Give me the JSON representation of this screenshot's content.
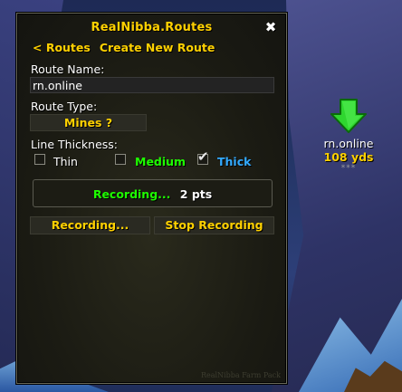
{
  "window": {
    "title": "RealNibba.Routes",
    "close_glyph": "✖",
    "watermark": "RealNibba Farm Pack"
  },
  "nav": {
    "back_label": "< Routes",
    "current_label": "Create New Route"
  },
  "form": {
    "route_name_label": "Route Name:",
    "route_name_value": "rn.online",
    "route_type_label": "Route Type:",
    "route_type_value": "Mines ?",
    "thickness_label": "Line Thickness:",
    "thickness_options": [
      {
        "label": "Thin",
        "checked": false,
        "color": "#ffffff"
      },
      {
        "label": "Medium",
        "checked": false,
        "color": "#1eff00"
      },
      {
        "label": "Thick",
        "checked": true,
        "color": "#33aaff"
      }
    ]
  },
  "status": {
    "recording_label": "Recording...",
    "points": "2 pts",
    "recording_color": "#1eff00"
  },
  "buttons": {
    "recording": "Recording...",
    "stop": "Stop Recording"
  },
  "waypoint": {
    "name": "rn.online",
    "distance": "108 yds",
    "stars": "***",
    "arrow_color": "#2fd62f"
  }
}
